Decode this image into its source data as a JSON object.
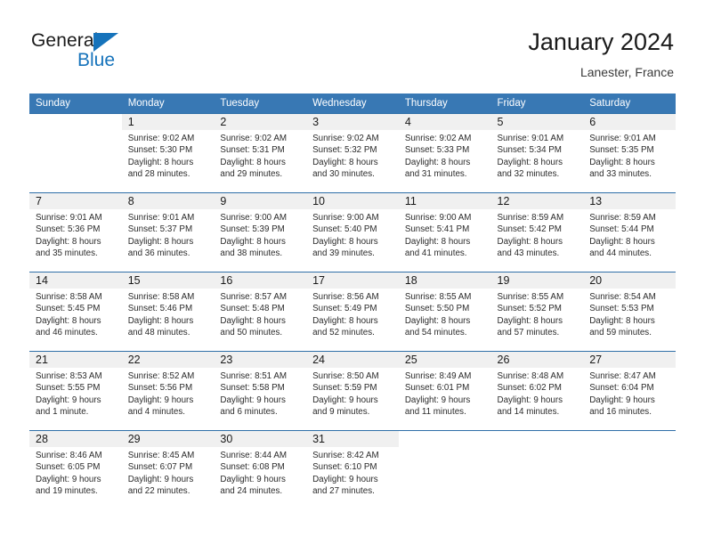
{
  "brand": {
    "name_top": "General",
    "name_bottom": "Blue",
    "flag_color": "#1673bb"
  },
  "header": {
    "title": "January 2024",
    "subtitle": "Lanester, France"
  },
  "theme": {
    "header_bar": "#3878b4",
    "row_divider": "#2f6fa8",
    "daynum_strip": "#f0f0f0"
  },
  "calendar": {
    "weekday_headers": [
      "Sunday",
      "Monday",
      "Tuesday",
      "Wednesday",
      "Thursday",
      "Friday",
      "Saturday"
    ],
    "weeks": [
      [
        {
          "day": "",
          "info": ""
        },
        {
          "day": "1",
          "info": "Sunrise: 9:02 AM\nSunset: 5:30 PM\nDaylight: 8 hours\nand 28 minutes."
        },
        {
          "day": "2",
          "info": "Sunrise: 9:02 AM\nSunset: 5:31 PM\nDaylight: 8 hours\nand 29 minutes."
        },
        {
          "day": "3",
          "info": "Sunrise: 9:02 AM\nSunset: 5:32 PM\nDaylight: 8 hours\nand 30 minutes."
        },
        {
          "day": "4",
          "info": "Sunrise: 9:02 AM\nSunset: 5:33 PM\nDaylight: 8 hours\nand 31 minutes."
        },
        {
          "day": "5",
          "info": "Sunrise: 9:01 AM\nSunset: 5:34 PM\nDaylight: 8 hours\nand 32 minutes."
        },
        {
          "day": "6",
          "info": "Sunrise: 9:01 AM\nSunset: 5:35 PM\nDaylight: 8 hours\nand 33 minutes."
        }
      ],
      [
        {
          "day": "7",
          "info": "Sunrise: 9:01 AM\nSunset: 5:36 PM\nDaylight: 8 hours\nand 35 minutes."
        },
        {
          "day": "8",
          "info": "Sunrise: 9:01 AM\nSunset: 5:37 PM\nDaylight: 8 hours\nand 36 minutes."
        },
        {
          "day": "9",
          "info": "Sunrise: 9:00 AM\nSunset: 5:39 PM\nDaylight: 8 hours\nand 38 minutes."
        },
        {
          "day": "10",
          "info": "Sunrise: 9:00 AM\nSunset: 5:40 PM\nDaylight: 8 hours\nand 39 minutes."
        },
        {
          "day": "11",
          "info": "Sunrise: 9:00 AM\nSunset: 5:41 PM\nDaylight: 8 hours\nand 41 minutes."
        },
        {
          "day": "12",
          "info": "Sunrise: 8:59 AM\nSunset: 5:42 PM\nDaylight: 8 hours\nand 43 minutes."
        },
        {
          "day": "13",
          "info": "Sunrise: 8:59 AM\nSunset: 5:44 PM\nDaylight: 8 hours\nand 44 minutes."
        }
      ],
      [
        {
          "day": "14",
          "info": "Sunrise: 8:58 AM\nSunset: 5:45 PM\nDaylight: 8 hours\nand 46 minutes."
        },
        {
          "day": "15",
          "info": "Sunrise: 8:58 AM\nSunset: 5:46 PM\nDaylight: 8 hours\nand 48 minutes."
        },
        {
          "day": "16",
          "info": "Sunrise: 8:57 AM\nSunset: 5:48 PM\nDaylight: 8 hours\nand 50 minutes."
        },
        {
          "day": "17",
          "info": "Sunrise: 8:56 AM\nSunset: 5:49 PM\nDaylight: 8 hours\nand 52 minutes."
        },
        {
          "day": "18",
          "info": "Sunrise: 8:55 AM\nSunset: 5:50 PM\nDaylight: 8 hours\nand 54 minutes."
        },
        {
          "day": "19",
          "info": "Sunrise: 8:55 AM\nSunset: 5:52 PM\nDaylight: 8 hours\nand 57 minutes."
        },
        {
          "day": "20",
          "info": "Sunrise: 8:54 AM\nSunset: 5:53 PM\nDaylight: 8 hours\nand 59 minutes."
        }
      ],
      [
        {
          "day": "21",
          "info": "Sunrise: 8:53 AM\nSunset: 5:55 PM\nDaylight: 9 hours\nand 1 minute."
        },
        {
          "day": "22",
          "info": "Sunrise: 8:52 AM\nSunset: 5:56 PM\nDaylight: 9 hours\nand 4 minutes."
        },
        {
          "day": "23",
          "info": "Sunrise: 8:51 AM\nSunset: 5:58 PM\nDaylight: 9 hours\nand 6 minutes."
        },
        {
          "day": "24",
          "info": "Sunrise: 8:50 AM\nSunset: 5:59 PM\nDaylight: 9 hours\nand 9 minutes."
        },
        {
          "day": "25",
          "info": "Sunrise: 8:49 AM\nSunset: 6:01 PM\nDaylight: 9 hours\nand 11 minutes."
        },
        {
          "day": "26",
          "info": "Sunrise: 8:48 AM\nSunset: 6:02 PM\nDaylight: 9 hours\nand 14 minutes."
        },
        {
          "day": "27",
          "info": "Sunrise: 8:47 AM\nSunset: 6:04 PM\nDaylight: 9 hours\nand 16 minutes."
        }
      ],
      [
        {
          "day": "28",
          "info": "Sunrise: 8:46 AM\nSunset: 6:05 PM\nDaylight: 9 hours\nand 19 minutes."
        },
        {
          "day": "29",
          "info": "Sunrise: 8:45 AM\nSunset: 6:07 PM\nDaylight: 9 hours\nand 22 minutes."
        },
        {
          "day": "30",
          "info": "Sunrise: 8:44 AM\nSunset: 6:08 PM\nDaylight: 9 hours\nand 24 minutes."
        },
        {
          "day": "31",
          "info": "Sunrise: 8:42 AM\nSunset: 6:10 PM\nDaylight: 9 hours\nand 27 minutes."
        },
        {
          "day": "",
          "info": ""
        },
        {
          "day": "",
          "info": ""
        },
        {
          "day": "",
          "info": ""
        }
      ]
    ]
  }
}
